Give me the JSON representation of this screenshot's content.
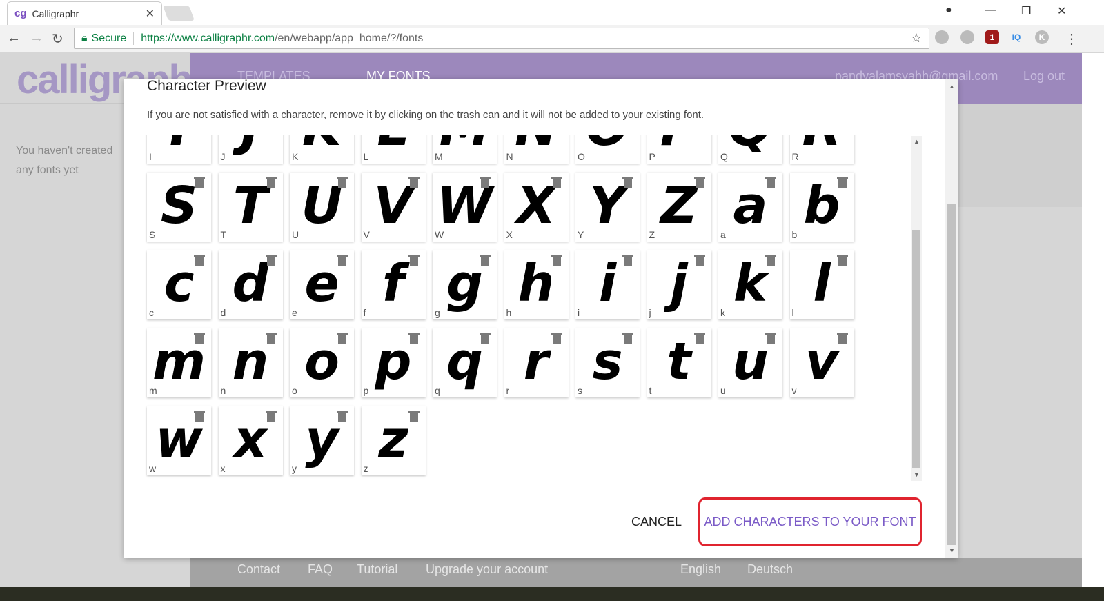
{
  "browser": {
    "tab_title": "Calligraphr",
    "secure_label": "Secure",
    "url_host": "https://www.calligraphr.com",
    "url_path": "/en/webapp/app_home/?/fonts",
    "ext_badge": "1"
  },
  "site": {
    "logo": "calligraphr",
    "nav": [
      "TEMPLATES",
      "MY FONTS"
    ],
    "email": "pandyalamsyahh@gmail.com",
    "logout": "Log out",
    "sidebar_text": "You haven't created any fonts yet",
    "header_color": "#9c88bc"
  },
  "modal": {
    "title": "Character Preview",
    "description": "If you are not satisfied with a character, remove it by clicking on the trash can and it will not be added to your existing font.",
    "cancel": "CANCEL",
    "add": "ADD CHARACTERS TO YOUR FONT",
    "add_color": "#7b5bc7",
    "highlight_color": "#e0242f"
  },
  "characters": [
    "I",
    "J",
    "K",
    "L",
    "M",
    "N",
    "O",
    "P",
    "Q",
    "R",
    "S",
    "T",
    "U",
    "V",
    "W",
    "X",
    "Y",
    "Z",
    "a",
    "b",
    "c",
    "d",
    "e",
    "f",
    "g",
    "h",
    "i",
    "j",
    "k",
    "l",
    "m",
    "n",
    "o",
    "p",
    "q",
    "r",
    "s",
    "t",
    "u",
    "v",
    "w",
    "x",
    "y",
    "z"
  ],
  "footer": {
    "links": [
      "Contact",
      "FAQ",
      "Tutorial",
      "Upgrade your account"
    ],
    "languages": [
      "English",
      "Deutsch"
    ]
  }
}
